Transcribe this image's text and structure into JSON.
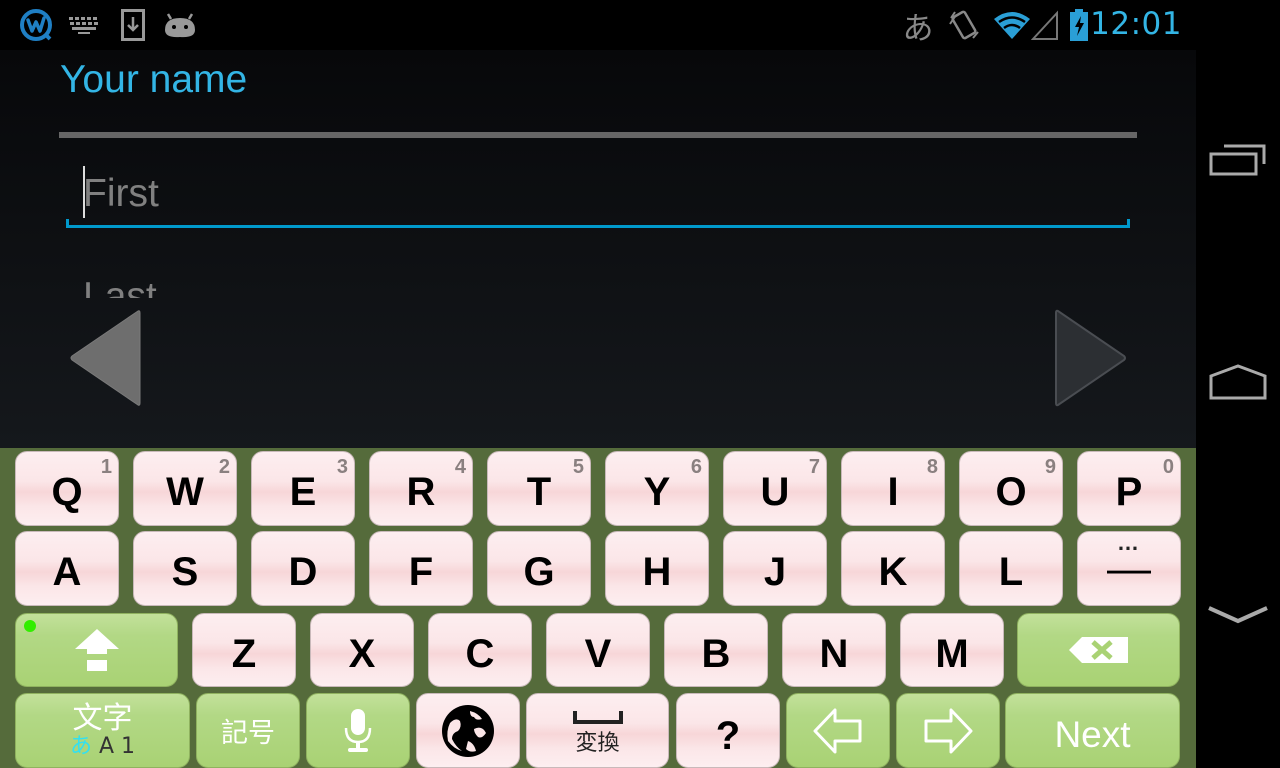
{
  "status_bar": {
    "left_icons": [
      "app-w-icon",
      "keyboard-icon",
      "download-icon",
      "android-icon"
    ],
    "right_icons": [
      "ime-hiragana-icon",
      "vibrate-icon",
      "wifi-icon",
      "signal-icon",
      "battery-charging-icon"
    ],
    "ime_glyph": "あ",
    "time": "12:01",
    "accent_color": "#33b5e5"
  },
  "form": {
    "section_title": "Your name",
    "first_field": {
      "placeholder": "First",
      "value": ""
    },
    "last_field": {
      "placeholder": "Last",
      "value": ""
    },
    "prev_label": "Previous",
    "next_label": "Next"
  },
  "nav_bar": {
    "buttons": [
      "recent-apps",
      "home",
      "hide-keyboard"
    ]
  },
  "keyboard": {
    "row1": [
      {
        "label": "Q",
        "hint": "1"
      },
      {
        "label": "W",
        "hint": "2"
      },
      {
        "label": "E",
        "hint": "3"
      },
      {
        "label": "R",
        "hint": "4"
      },
      {
        "label": "T",
        "hint": "5"
      },
      {
        "label": "Y",
        "hint": "6"
      },
      {
        "label": "U",
        "hint": "7"
      },
      {
        "label": "I",
        "hint": "8"
      },
      {
        "label": "O",
        "hint": "9"
      },
      {
        "label": "P",
        "hint": "0"
      }
    ],
    "row2": [
      {
        "label": "A"
      },
      {
        "label": "S"
      },
      {
        "label": "D"
      },
      {
        "label": "F"
      },
      {
        "label": "G"
      },
      {
        "label": "H"
      },
      {
        "label": "J"
      },
      {
        "label": "K"
      },
      {
        "label": "L"
      },
      {
        "label": "—",
        "hint": "…"
      }
    ],
    "row3": [
      {
        "label": "Z"
      },
      {
        "label": "X"
      },
      {
        "label": "C"
      },
      {
        "label": "V"
      },
      {
        "label": "B"
      },
      {
        "label": "N"
      },
      {
        "label": "M"
      }
    ],
    "mode_key": {
      "label": "文字",
      "sub_hira": "あ",
      "sub_rest": "A 1"
    },
    "symbol_key": "記号",
    "convert_key": "変換",
    "question_key": "?",
    "enter_key": "Next",
    "colors": {
      "background": "#556b3b",
      "letter_key": "#fbe6e8",
      "function_key": "#aed47a",
      "shift_indicator": "#33ee00"
    }
  }
}
